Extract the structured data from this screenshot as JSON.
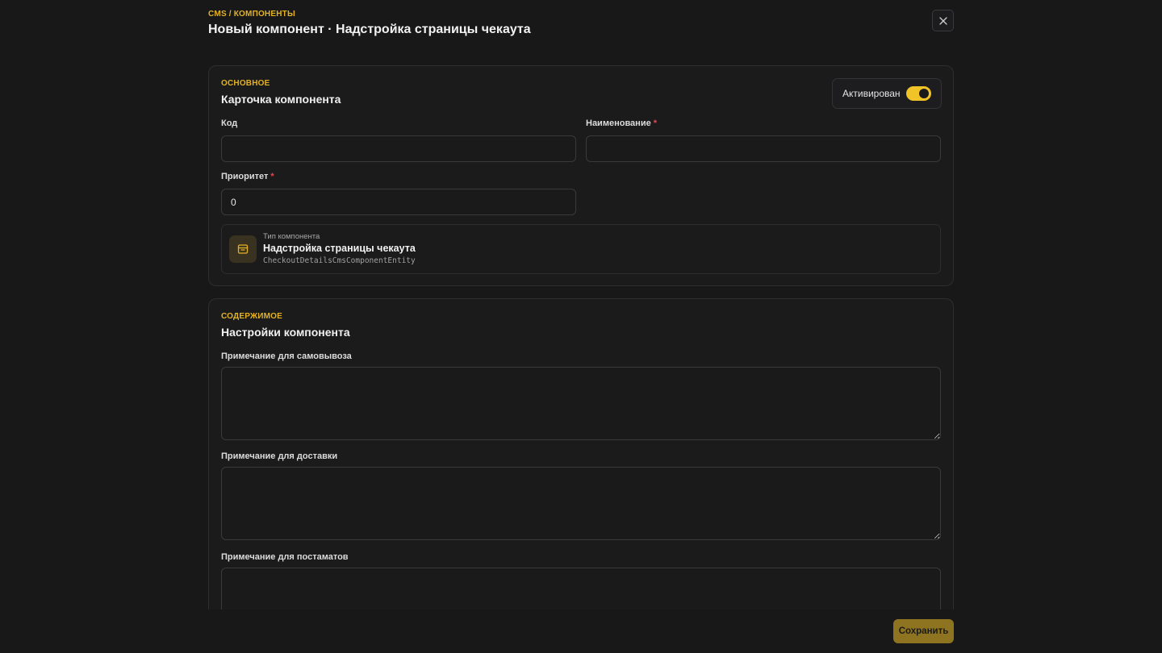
{
  "header": {
    "breadcrumb": "CMS / КОМПОНЕНТЫ",
    "title": "Новый компонент · Надстройка страницы чекаута"
  },
  "main_card": {
    "eyebrow": "ОСНОВНОЕ",
    "title": "Карточка компонента",
    "toggle_label": "Активирован",
    "toggle_on": true,
    "code_label": "Код",
    "code_value": "",
    "name_label": "Наименование",
    "name_value": "",
    "priority_label": "Приоритет",
    "priority_value": "0",
    "required_mark": "*",
    "type": {
      "caption": "Тип компонента",
      "name": "Надстройка страницы чекаута",
      "class_name": "CheckoutDetailsCmsComponentEntity"
    }
  },
  "content_card": {
    "eyebrow": "СОДЕРЖИМОЕ",
    "title": "Настройки компонента",
    "pickup_label": "Примечание для самовывоза",
    "delivery_label": "Примечание для доставки",
    "postamat_label": "Примечание для постаматов"
  },
  "footer": {
    "save_label": "Сохранить"
  },
  "colors": {
    "accent": "#e3b224",
    "background": "#181819",
    "required": "#e5484d"
  }
}
